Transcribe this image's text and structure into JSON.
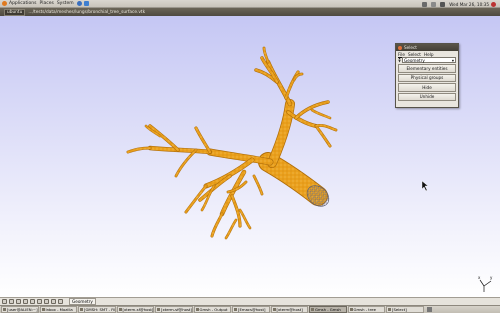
{
  "top_panel": {
    "menus": [
      "Applications",
      "Places",
      "System"
    ],
    "clock": "Wed Mar 26, 10:35"
  },
  "window": {
    "title_button": "ubuntu",
    "title": "…/tests/data/meshes/lungs/bronchial_tree_surface.vtk"
  },
  "tool_window": {
    "title": "Select",
    "menus": [
      "File",
      "Select",
      "Help"
    ],
    "select_value": "Geometry",
    "buttons": [
      "Elementary entities",
      "Physical groups",
      "Hide",
      "Unhide"
    ]
  },
  "statusbar": {
    "field": "Geometry"
  },
  "taskbar": {
    "tasks": [
      {
        "label": "[user@ALIEN:~]"
      },
      {
        "label": "Inbox - Mozilla"
      },
      {
        "label": "[GMSH: SMT - Fil"
      },
      {
        "label": "[xterm-sf@host]"
      },
      {
        "label": "[xterm-sf@host]"
      },
      {
        "label": "Gmsh - Output"
      },
      {
        "label": "[Emacs@host]"
      },
      {
        "label": "[xterm@host]"
      },
      {
        "label": "Gmsh - Gmsh",
        "active": true
      },
      {
        "label": "Gmsh - tree"
      },
      {
        "label": "[Select]"
      }
    ]
  },
  "colors": {
    "branch_fill": "#eaa01d",
    "branch_edge": "#b06d08",
    "mesh": "#8a8a9a"
  }
}
